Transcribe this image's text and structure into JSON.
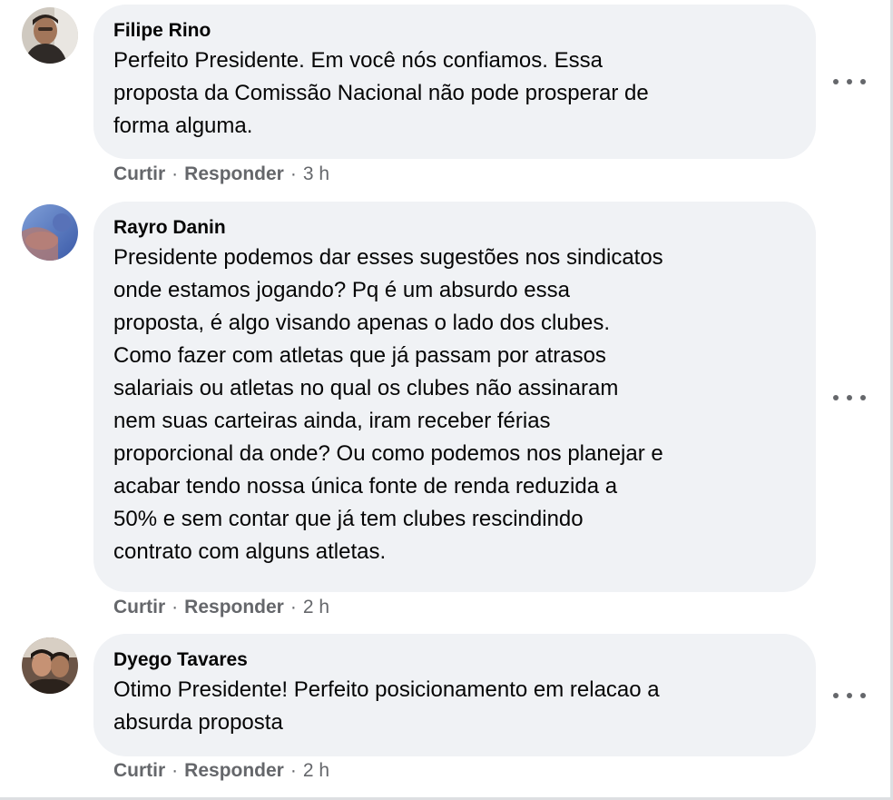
{
  "comments": [
    {
      "author": "Filipe Rino",
      "avatar_icon": "profile-photo",
      "text": "Perfeito Presidente. Em você nós confiamos. Essa\nproposta da Comissão Nacional não pode prosperar de\nforma alguma.",
      "like_label": "Curtir",
      "reply_label": "Responder",
      "separator": "·",
      "time": "3 h"
    },
    {
      "author": "Rayro Danin",
      "avatar_icon": "profile-photo",
      "text": "Presidente podemos dar esses sugestões nos sindicatos\nonde estamos jogando? Pq é um absurdo essa\nproposta, é algo visando apenas o lado dos clubes.\nComo fazer com atletas que já passam por atrasos\nsalariais ou atletas no qual os clubes não assinaram\nnem suas carteiras ainda, iram receber férias\nproporcional da onde? Ou como podemos nos planejar e\nacabar tendo nossa única fonte de renda reduzida a\n50% e sem contar que já tem clubes rescindindo\ncontrato com alguns atletas.",
      "like_label": "Curtir",
      "reply_label": "Responder",
      "separator": "·",
      "time": "2 h"
    },
    {
      "author": "Dyego Tavares",
      "avatar_icon": "profile-photo",
      "text": "Otimo Presidente! Perfeito posicionamento em relacao a\nabsurda proposta",
      "like_label": "Curtir",
      "reply_label": "Responder",
      "separator": "·",
      "time": "2 h"
    }
  ],
  "colors": {
    "bubble": "#f0f2f5",
    "secondary_text": "#65676b",
    "primary_text": "#050505"
  }
}
